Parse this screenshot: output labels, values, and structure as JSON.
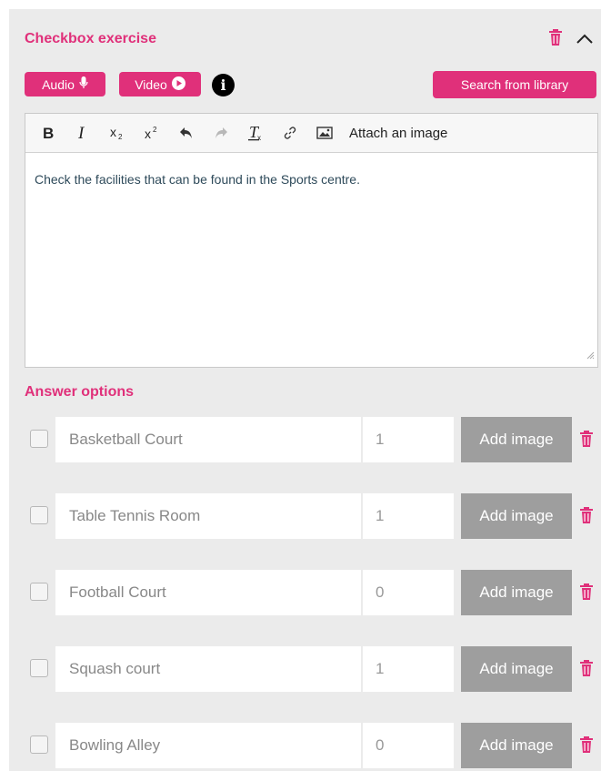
{
  "header": {
    "title": "Checkbox exercise"
  },
  "toolbar_buttons": {
    "audio": "Audio",
    "video": "Video",
    "info_glyph": "i",
    "search_library": "Search from library"
  },
  "editor": {
    "attach_label": "Attach an image",
    "content": "Check the facilities that can be found in the Sports centre.",
    "tool_icons": [
      "bold-icon",
      "italic-icon",
      "subscript-icon",
      "superscript-icon",
      "undo-icon",
      "redo-icon",
      "clear-format-icon",
      "link-icon",
      "image-icon"
    ]
  },
  "answers": {
    "title": "Answer options",
    "add_image_label": "Add image",
    "items": [
      {
        "text": "Basketball Court",
        "score": "1"
      },
      {
        "text": "Table Tennis Room",
        "score": "1"
      },
      {
        "text": "Football Court",
        "score": "0"
      },
      {
        "text": "Squash court",
        "score": "1"
      },
      {
        "text": "Bowling Alley",
        "score": "0"
      }
    ]
  },
  "colors": {
    "accent": "#e0307a",
    "panel": "#ebebeb",
    "add_image_bg": "#9e9e9e"
  }
}
